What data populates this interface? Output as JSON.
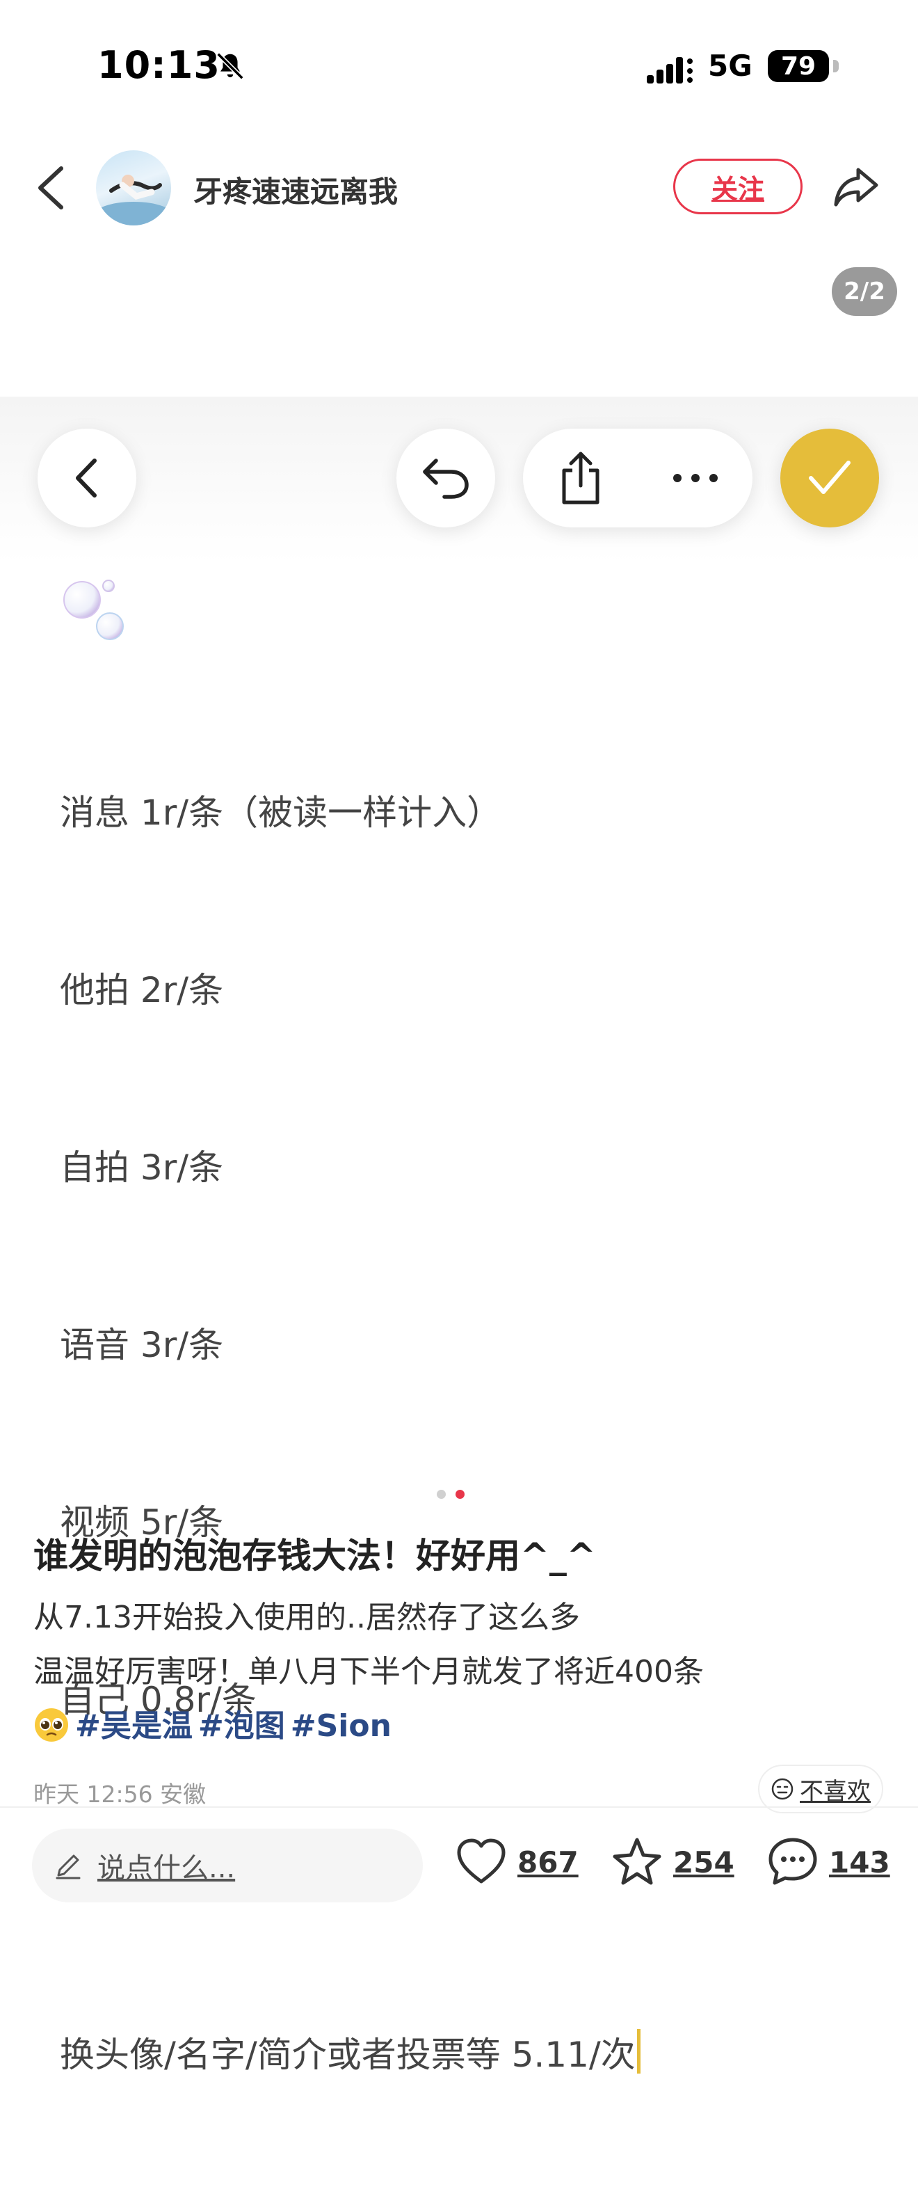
{
  "status_bar": {
    "time": "10:13",
    "network": "5G",
    "battery": "79"
  },
  "nav": {
    "author_name": "牙疼速速远离我",
    "follow_label": "关注"
  },
  "gallery": {
    "page_indicator": "2/2",
    "page_count": 2,
    "current_page": 2
  },
  "note_image": {
    "lines": [
      "消息 1r/条（被读一样计入）",
      "他拍 2r/条",
      "自拍 3r/条",
      "语音 3r/条",
      "视频 5r/条",
      "自己 0.8r/条",
      "",
      "换头像/名字/简介或者投票等 5.11/次"
    ]
  },
  "post": {
    "title": "谁发明的泡泡存钱大法！好好用^_^",
    "body_line_1": "从7.13开始投入使用的..居然存了这么多",
    "body_line_2": "温温好厉害呀！单八月下半个月就发了将近400条",
    "tags": [
      "#吴是温",
      "#泡图",
      "#Sion"
    ],
    "meta": "昨天 12:56 安徽",
    "dislike_label": "不喜欢"
  },
  "bottom_bar": {
    "comment_placeholder": "说点什么...",
    "likes": "867",
    "favorites": "254",
    "comments": "143"
  }
}
